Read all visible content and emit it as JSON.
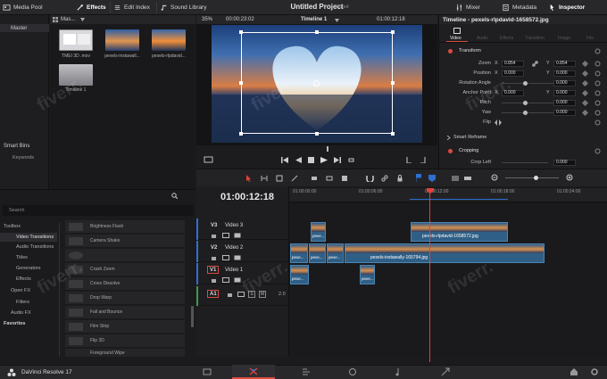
{
  "topbar": {
    "media_pool": "Media Pool",
    "effects": "Effects",
    "edit_index": "Edit Index",
    "sound_library": "Sound Library",
    "project_title": "Untitled Project",
    "project_status": "Edited",
    "mixer": "Mixer",
    "metadata": "Metadata",
    "inspector": "Inspector"
  },
  "media_pool": {
    "bin_label": "Mas...",
    "master": "Master",
    "smart_bins": "Smart Bins",
    "keywords": "Keywords",
    "clips": [
      {
        "name": "TMEI 3D .mov"
      },
      {
        "name": "pexels-instawall..."
      },
      {
        "name": "pexels-rlpdavid..."
      },
      {
        "name": "Timeline 1"
      }
    ]
  },
  "viewer": {
    "zoom": "35%",
    "timecode_left": "00:00:23:02",
    "timeline_name": "Timeline 1",
    "timecode_right": "01:00:12:18"
  },
  "inspector": {
    "title": "Timeline - pexels-rlpdavid-1658572.jpg",
    "tabs": [
      "Video",
      "Audio",
      "Effects",
      "Transition",
      "Image",
      "File"
    ],
    "sections": {
      "transform": "Transform",
      "smart_reframe": "Smart Reframe",
      "cropping": "Cropping"
    },
    "rows": [
      {
        "label": "Zoom",
        "x": "0.854",
        "y": "0.854"
      },
      {
        "label": "Position",
        "x": "0.000",
        "y": "0.000"
      },
      {
        "label": "Rotation Angle",
        "value": "0.000"
      },
      {
        "label": "Anchor Point",
        "x": "0.000",
        "y": "0.000"
      },
      {
        "label": "Pitch",
        "value": "0.000"
      },
      {
        "label": "Yaw",
        "value": "0.000"
      },
      {
        "label": "Flip"
      },
      {
        "label": "Crop Left",
        "value": "0.000"
      }
    ],
    "axis_x": "X",
    "axis_y": "Y"
  },
  "effects_panel": {
    "search": "Search",
    "categories": [
      "Toolbox",
      "Video Transitions",
      "Audio Transitions",
      "Titles",
      "Generators",
      "Effects",
      "Open FX",
      "Filters",
      "Audio FX",
      "Favorites"
    ],
    "items": [
      "Brightness Flash",
      "Camera Shake",
      "",
      "Crash Zoom",
      "Cross Dissolve",
      "Drop Warp",
      "Fall and Bounce",
      "Film Strip",
      "Flip 3D",
      "Foreground Wipe"
    ]
  },
  "timeline": {
    "timecode": "01:00:12:18",
    "ruler": [
      "01:00:00:00",
      "01:00:06:00",
      "01:00:12:00",
      "01:00:18:00",
      "01:00:24:00"
    ],
    "tracks": [
      {
        "id": "V3",
        "name": "Video 3"
      },
      {
        "id": "V2",
        "name": "Video 2"
      },
      {
        "id": "V1",
        "name": "Video 1"
      },
      {
        "id": "A1",
        "name": "",
        "level": "2.0"
      }
    ],
    "clips": [
      "pexels-rlpdavid-1658572.jpg",
      "pexels-instawally-165794.jpg",
      "pexe...",
      "pexe...",
      "pexe...",
      "pexe...",
      "pexe...",
      "pexe..."
    ]
  },
  "bottombar": {
    "app_name": "DaVinci Resolve 17"
  },
  "watermark": "fiverr.",
  "colors": {
    "accent": "#d94b3f",
    "playhead": "#e0423a",
    "clip": "#2f5f86"
  }
}
